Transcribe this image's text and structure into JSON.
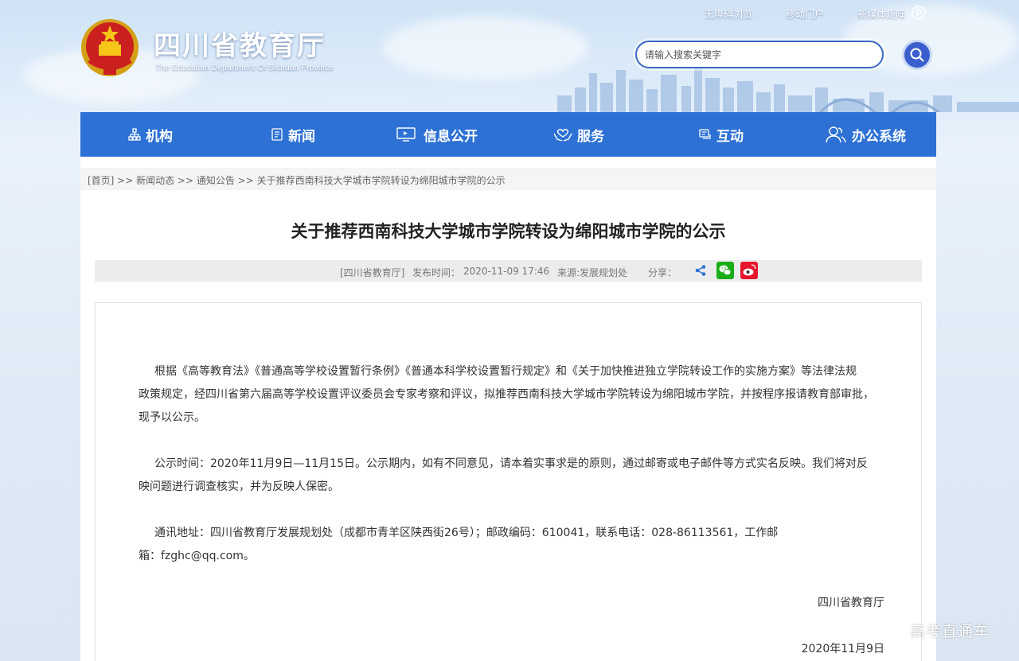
{
  "header": {
    "title": "四川省教育厅",
    "subtitle": "The Education Department Of Sichuan Province",
    "links": [
      "无障碍浏览",
      "移动门户",
      "新媒体矩阵"
    ],
    "search": {
      "placeholder": "请输入搜索关键字"
    }
  },
  "nav": {
    "items": [
      {
        "label": "机构",
        "icon": "org-icon"
      },
      {
        "label": "新闻",
        "icon": "news-icon"
      },
      {
        "label": "信息公开",
        "icon": "monitor-icon"
      },
      {
        "label": "服务",
        "icon": "service-hands-icon"
      },
      {
        "label": "互动",
        "icon": "chat-icon"
      },
      {
        "label": "办公系统",
        "icon": "users-icon"
      }
    ]
  },
  "breadcrumb": "[首页] >> 新闻动态 >> 通知公告 >> 关于推荐西南科技大学城市学院转设为绵阳城市学院的公示",
  "article": {
    "title": "关于推荐西南科技大学城市学院转设为绵阳城市学院的公示",
    "meta": {
      "source_tag": "[四川省教育厅]",
      "publish_label": "发布时间：",
      "publish_time": "2020-11-09 17:46",
      "origin": "来源:发展规划处",
      "share_label": "分享："
    },
    "paragraphs": [
      {
        "lines": [
          "根据《高等教育法》《普通高等学校设置暂行条例》《普通本科学校设置暂行规定》和《关于加快推进独立学院转设工作的实施方案》等法律法规",
          "政策规定，经四川省第六届高等学校设置评议委员会专家考察和评议，拟推荐西南科技大学城市学院转设为绵阳城市学院，并按程序报请教育部审批，",
          "现予以公示。"
        ]
      },
      {
        "lines": [
          "公示时间：2020年11月9日—11月15日。公示期内，如有不同意见，请本着实事求是的原则，通过邮寄或电子邮件等方式实名反映。我们将对反",
          "映问题进行调查核实，并为反映人保密。"
        ]
      },
      {
        "lines": [
          "通讯地址：四川省教育厅发展规划处（成都市青羊区陕西街26号）；邮政编码：610041，联系电话：028-86113561，工作邮",
          "箱：fzghc@qq.com。"
        ]
      }
    ],
    "signature": "四川省教育厅",
    "date": "2020年11月9日"
  },
  "watermark": "高考直通车",
  "colors": {
    "nav_bg": "#2d71d4",
    "search_btn": "#3a5fcd",
    "wechat": "#1aad19",
    "weibo": "#e6162d",
    "share": "#2d71d4"
  }
}
